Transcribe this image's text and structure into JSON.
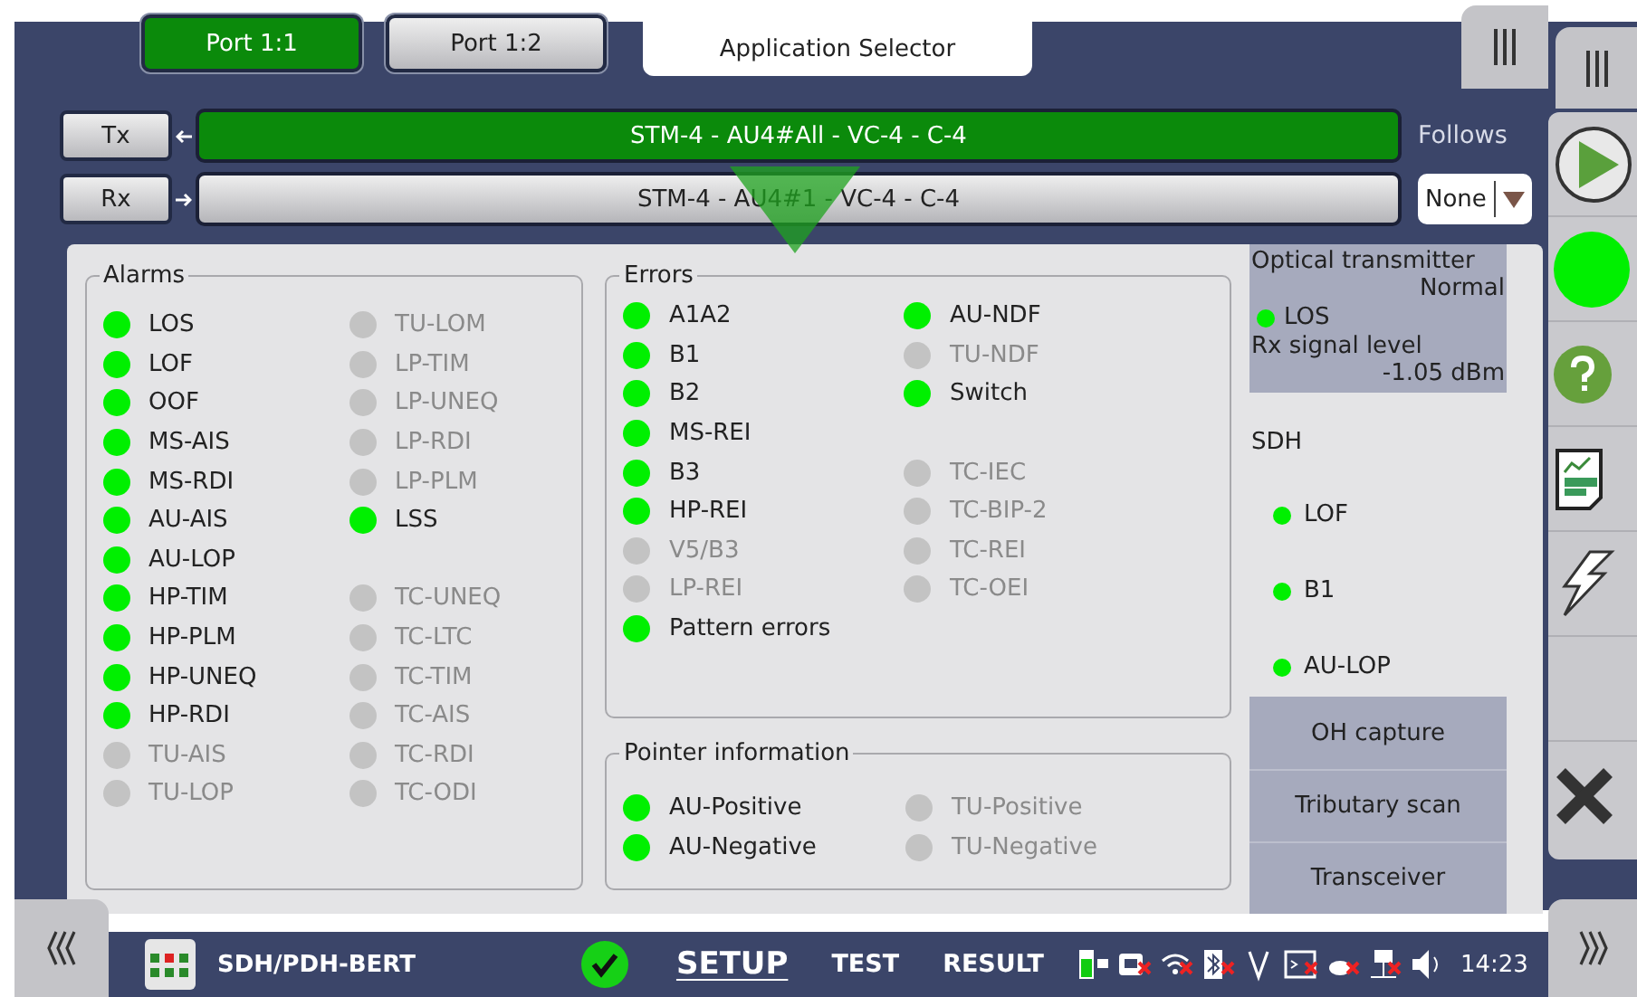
{
  "ports": [
    {
      "label": "Port 1:1",
      "selected": true
    },
    {
      "label": "Port 1:2",
      "selected": false
    }
  ],
  "application_selector": "Application Selector",
  "paths": [
    {
      "kind": "tx",
      "button": "Tx",
      "path": "STM-4 - AU4#All - VC-4 - C-4",
      "active": true
    },
    {
      "kind": "rx",
      "button": "Rx",
      "path": "STM-4 - AU4#1 - VC-4 - C-4",
      "active": false
    }
  ],
  "follows": {
    "label": "Follows",
    "value": "None"
  },
  "alarms": {
    "title": "Alarms",
    "columns": [
      [
        [
          {
            "label": "LOS",
            "disabled": false
          },
          {
            "label": "LOF",
            "disabled": false
          },
          {
            "label": "OOF",
            "disabled": false
          },
          {
            "label": "MS-AIS",
            "disabled": false
          },
          {
            "label": "MS-RDI",
            "disabled": false
          },
          {
            "label": "AU-AIS",
            "disabled": false
          },
          {
            "label": "AU-LOP",
            "disabled": false
          },
          {
            "label": "HP-TIM",
            "disabled": false
          },
          {
            "label": "HP-PLM",
            "disabled": false
          },
          {
            "label": "HP-UNEQ",
            "disabled": false
          },
          {
            "label": "HP-RDI",
            "disabled": false
          },
          {
            "label": "TU-AIS",
            "disabled": true
          },
          {
            "label": "TU-LOP",
            "disabled": true
          }
        ]
      ],
      [
        [
          {
            "label": "TU-LOM",
            "disabled": true
          },
          {
            "label": "LP-TIM",
            "disabled": true
          },
          {
            "label": "LP-UNEQ",
            "disabled": true
          },
          {
            "label": "LP-RDI",
            "disabled": true
          },
          {
            "label": "LP-PLM",
            "disabled": true
          },
          {
            "label": "LSS",
            "disabled": false
          }
        ],
        [
          {
            "label": "TC-UNEQ",
            "disabled": true
          },
          {
            "label": "TC-LTC",
            "disabled": true
          },
          {
            "label": "TC-TIM",
            "disabled": true
          },
          {
            "label": "TC-AIS",
            "disabled": true
          },
          {
            "label": "TC-RDI",
            "disabled": true
          },
          {
            "label": "TC-ODI",
            "disabled": true
          }
        ]
      ]
    ]
  },
  "errors": {
    "title": "Errors",
    "columns": [
      [
        [
          {
            "label": "A1A2",
            "disabled": false
          },
          {
            "label": "B1",
            "disabled": false
          },
          {
            "label": "B2",
            "disabled": false
          },
          {
            "label": "MS-REI",
            "disabled": false
          },
          {
            "label": "B3",
            "disabled": false
          },
          {
            "label": "HP-REI",
            "disabled": false
          },
          {
            "label": "V5/B3",
            "disabled": true
          },
          {
            "label": "LP-REI",
            "disabled": true
          },
          {
            "label": "Pattern errors",
            "disabled": false
          }
        ]
      ],
      [
        [
          {
            "label": "AU-NDF",
            "disabled": false
          },
          {
            "label": "TU-NDF",
            "disabled": true
          },
          {
            "label": "Switch",
            "disabled": false
          }
        ],
        [
          {
            "label": "TC-IEC",
            "disabled": true
          },
          {
            "label": "TC-BIP-2",
            "disabled": true
          },
          {
            "label": "TC-REI",
            "disabled": true
          },
          {
            "label": "TC-OEI",
            "disabled": true
          }
        ]
      ]
    ]
  },
  "pointer_information": {
    "title": "Pointer information",
    "columns": [
      [
        [
          {
            "label": "AU-Positive",
            "disabled": false
          },
          {
            "label": "AU-Negative",
            "disabled": false
          }
        ]
      ],
      [
        [
          {
            "label": "TU-Positive",
            "disabled": true
          },
          {
            "label": "TU-Negative",
            "disabled": true
          }
        ]
      ]
    ]
  },
  "side_panel": {
    "optical": {
      "title": "Optical transmitter",
      "status": "Normal",
      "indicator": {
        "label": "LOS",
        "disabled": false
      },
      "level_label": "Rx signal level",
      "level_value": "-1.05 dBm"
    },
    "sdh": {
      "title": "SDH",
      "items": [
        {
          "label": "LOF",
          "disabled": false
        },
        {
          "label": "B1",
          "disabled": false
        },
        {
          "label": "AU-LOP",
          "disabled": false
        }
      ]
    },
    "buttons": [
      "OH capture",
      "Tributary scan",
      "Transceiver"
    ]
  },
  "bottom_bar": {
    "app_name": "SDH/PDH-BERT",
    "tabs": [
      {
        "label": "SETUP",
        "selected": true
      },
      {
        "label": "TEST",
        "selected": false
      },
      {
        "label": "RESULT",
        "selected": false
      }
    ],
    "clock": "14:23"
  }
}
